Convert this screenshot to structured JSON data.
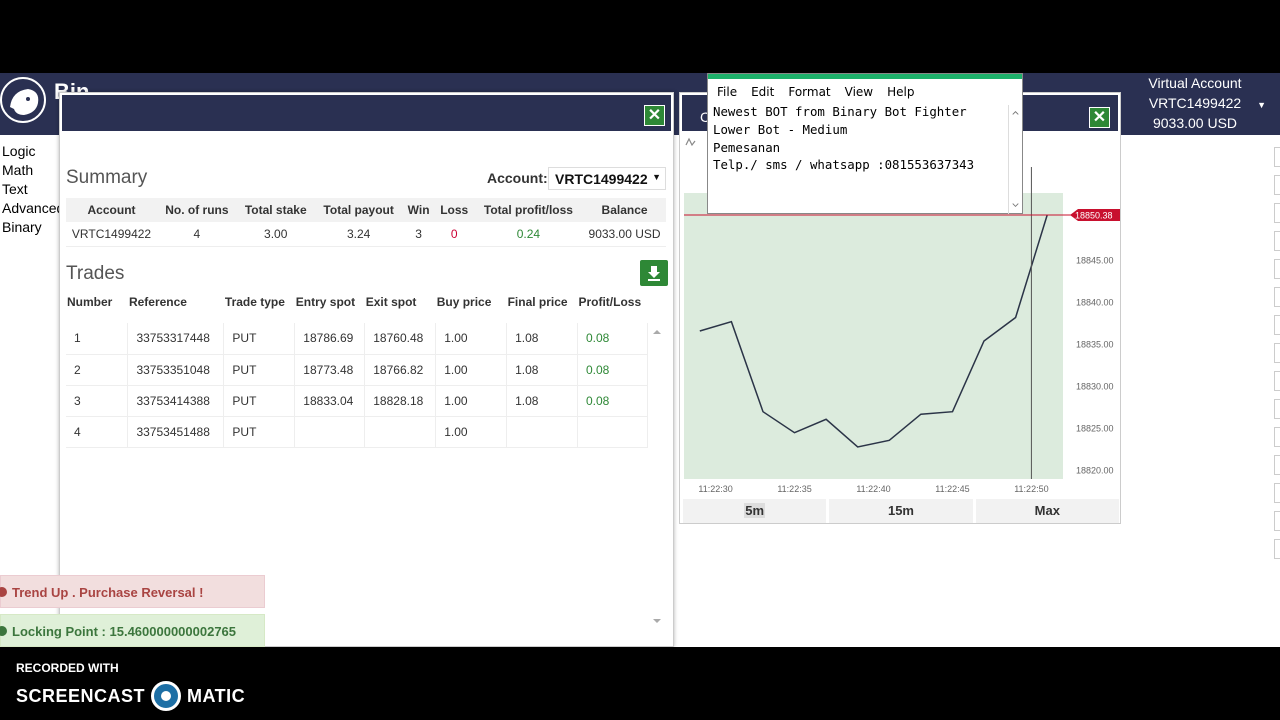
{
  "header": {
    "brand": "Bin",
    "virtual_account": {
      "title": "Virtual Account",
      "id": "VRTC1499422",
      "balance": "9033.00 USD"
    }
  },
  "blockly_categories": [
    "Logic",
    "Math",
    "Text",
    "Advanced",
    "Binary"
  ],
  "summary": {
    "title": "Summary",
    "account_label": "Account:",
    "account_value": "VRTC1499422",
    "columns": [
      "Account",
      "No. of runs",
      "Total stake",
      "Total payout",
      "Win",
      "Loss",
      "Total profit/loss",
      "Balance"
    ],
    "row": [
      "VRTC1499422",
      "4",
      "3.00",
      "3.24",
      "3",
      "0",
      "0.24",
      "9033.00 USD"
    ]
  },
  "trades": {
    "title": "Trades",
    "columns": [
      "Number",
      "Reference",
      "Trade type",
      "Entry spot",
      "Exit spot",
      "Buy price",
      "Final price",
      "Profit/Loss"
    ],
    "rows": [
      [
        "1",
        "33753317448",
        "PUT",
        "18786.69",
        "18760.48",
        "1.00",
        "1.08",
        "0.08"
      ],
      [
        "2",
        "33753351048",
        "PUT",
        "18773.48",
        "18766.82",
        "1.00",
        "1.08",
        "0.08"
      ],
      [
        "3",
        "33753414388",
        "PUT",
        "18833.04",
        "18828.18",
        "1.00",
        "1.08",
        "0.08"
      ],
      [
        "4",
        "33753451488",
        "PUT",
        "",
        "",
        "1.00",
        "",
        ""
      ]
    ]
  },
  "notifications": {
    "error": "Trend Up . Purchase Reversal !",
    "success": "Locking Point : 15.460000000002765"
  },
  "notepad": {
    "menu": [
      "File",
      "Edit",
      "Format",
      "View",
      "Help"
    ],
    "lines": [
      "Newest BOT from Binary Bot Fighter",
      "Lower Bot - Medium",
      "Pemesanan",
      "Telp./ sms / whatsapp :081553637343"
    ]
  },
  "chart_dialog": {
    "title_initial": "C",
    "tabs": [
      "5m",
      "15m",
      "Max"
    ],
    "current_price": "18850.38"
  },
  "recorder": {
    "line1": "RECORDED WITH",
    "left": "SCREENCAST",
    "right": "MATIC"
  },
  "colors": {
    "navy": "#2a3052",
    "green": "#2e8836",
    "chart_fill": "#dcebdd",
    "price_tag": "#c8102e"
  },
  "chart_data": {
    "type": "line",
    "x": [
      "11:22:29",
      "11:22:31",
      "11:22:33",
      "11:22:35",
      "11:22:37",
      "11:22:39",
      "11:22:41",
      "11:22:43",
      "11:22:45",
      "11:22:47",
      "11:22:49",
      "11:22:51"
    ],
    "y": [
      18836.6,
      18837.7,
      18827.0,
      18824.5,
      18826.1,
      18822.8,
      18823.6,
      18826.7,
      18827.0,
      18835.4,
      18838.2,
      18850.38
    ],
    "xticks": [
      "11:22:30",
      "11:22:35",
      "11:22:40",
      "11:22:45",
      "11:22:50"
    ],
    "yticks": [
      "18820.00",
      "18825.00",
      "18830.00",
      "18835.00",
      "18840.00",
      "18845.00"
    ],
    "ylim": [
      18819,
      18853
    ],
    "grid": true
  }
}
